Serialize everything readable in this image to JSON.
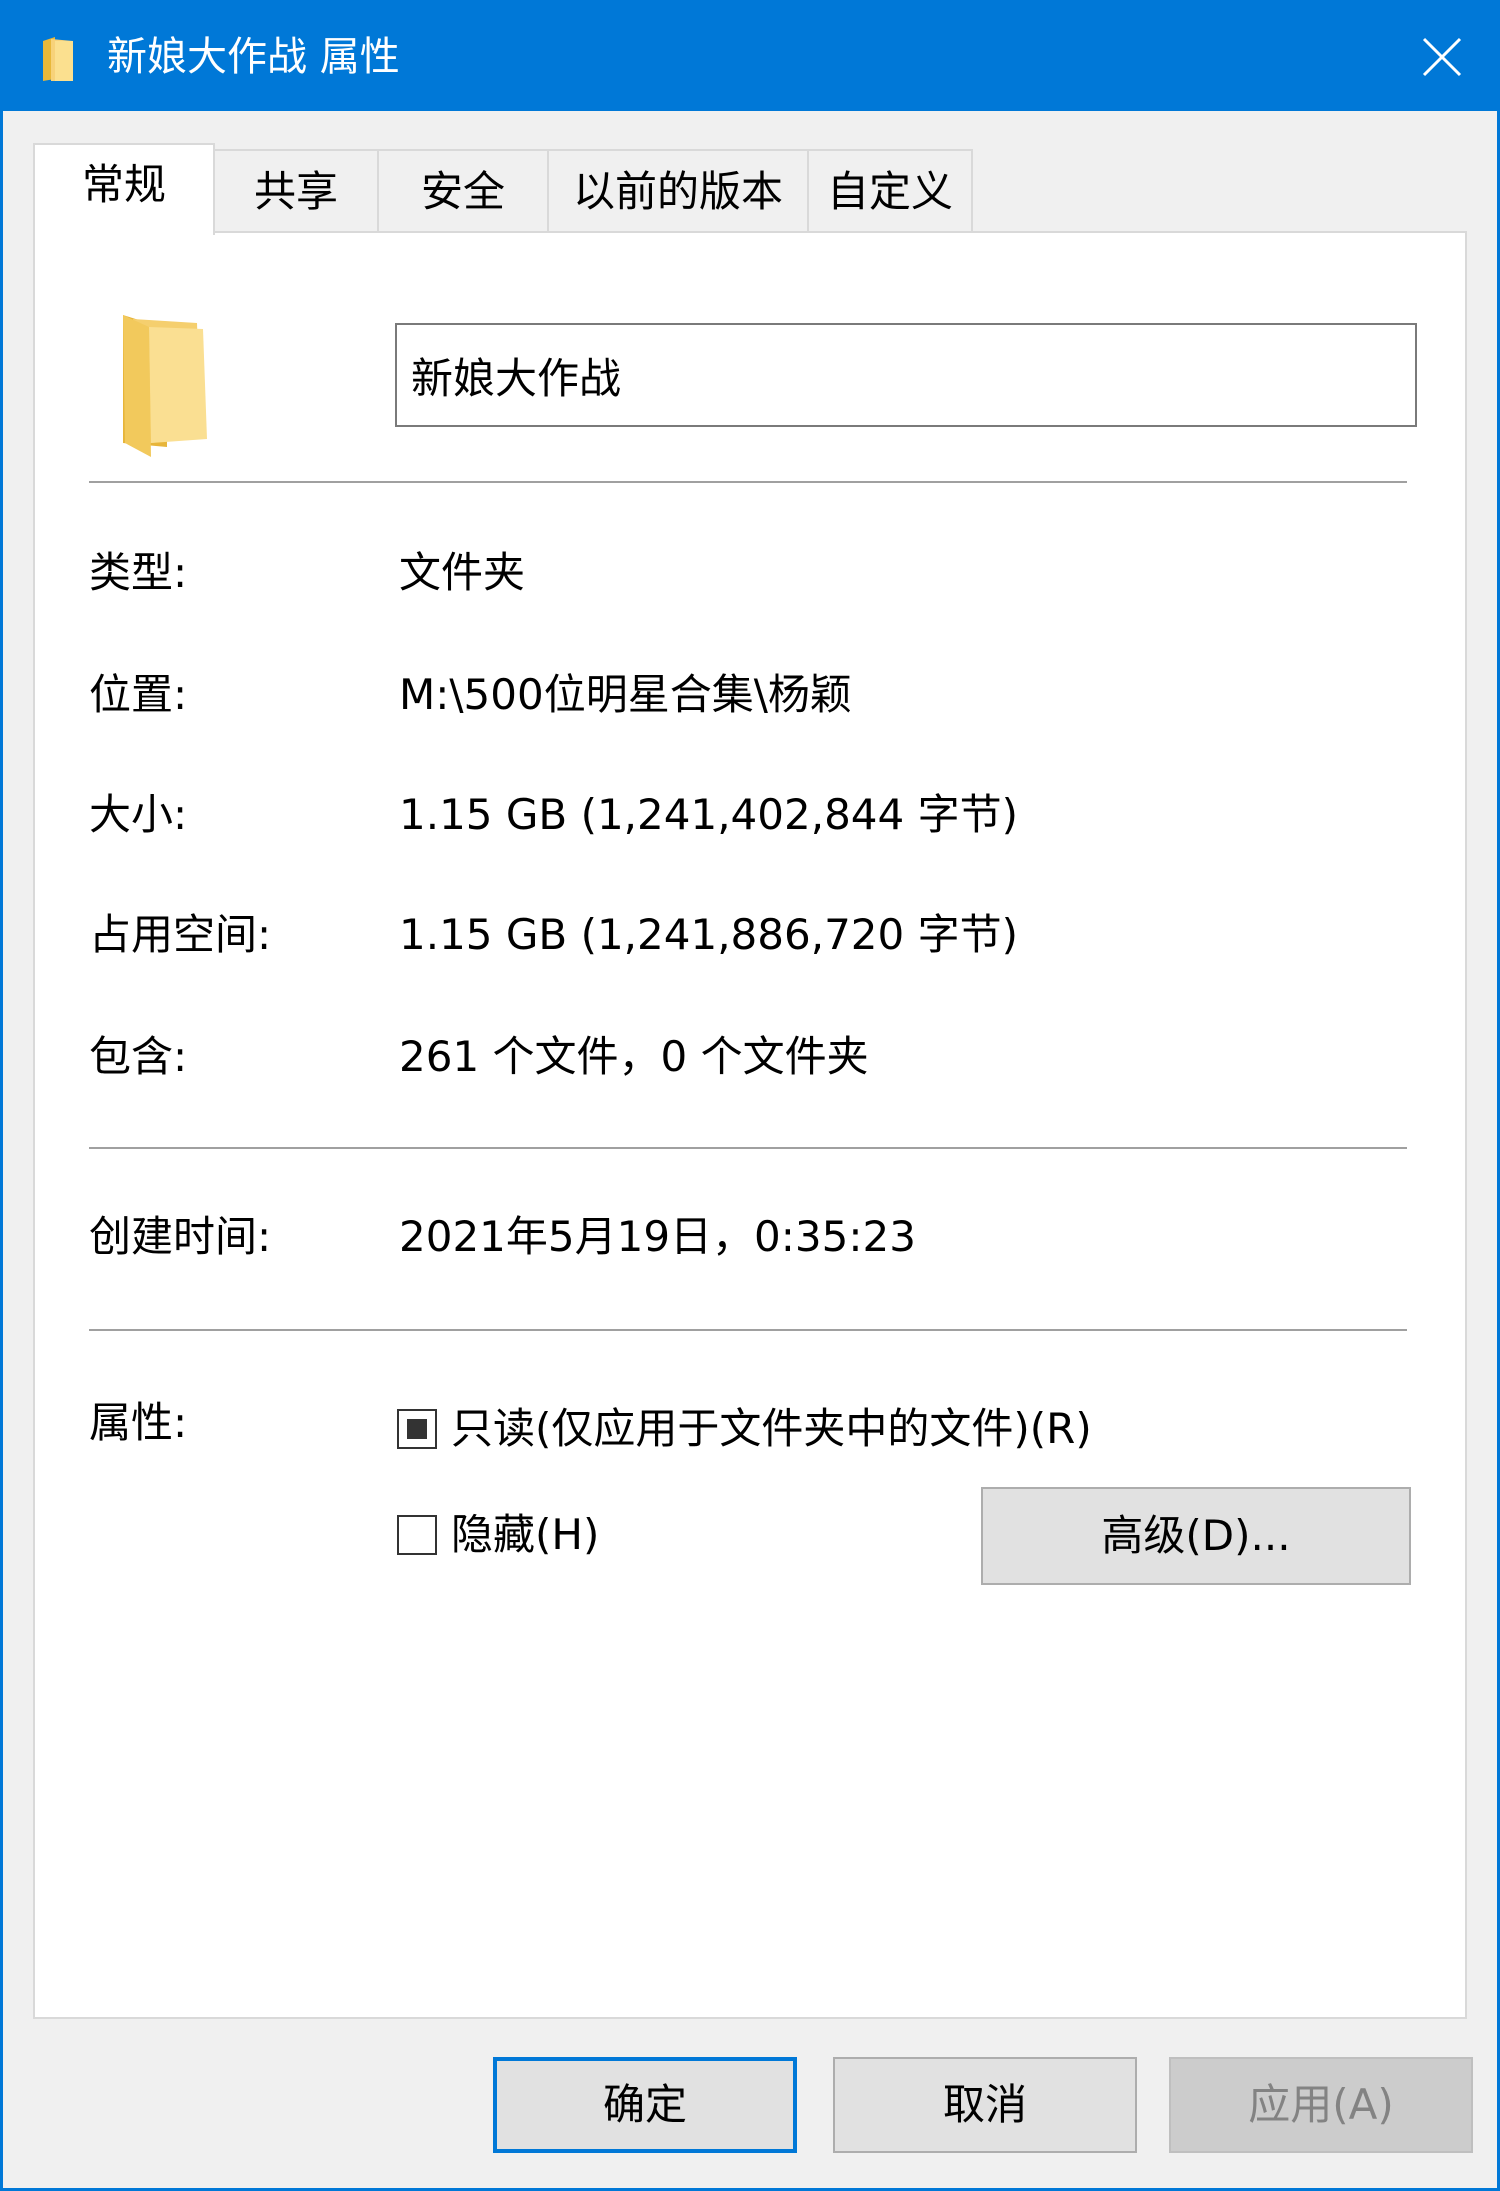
{
  "window": {
    "title": "新娘大作战 属性",
    "title_icon": "folder-icon",
    "close_icon": "close-icon"
  },
  "tabs": [
    {
      "label": "常规",
      "active": true
    },
    {
      "label": "共享",
      "active": false
    },
    {
      "label": "安全",
      "active": false
    },
    {
      "label": "以前的版本",
      "active": false
    },
    {
      "label": "自定义",
      "active": false
    }
  ],
  "general": {
    "folder_name": "新娘大作战",
    "rows": [
      {
        "label": "类型:",
        "value": "文件夹"
      },
      {
        "label": "位置:",
        "value": "M:\\500位明星合集\\杨颖"
      },
      {
        "label": "大小:",
        "value": "1.15 GB (1,241,402,844 字节)"
      },
      {
        "label": "占用空间:",
        "value": "1.15 GB (1,241,886,720 字节)"
      },
      {
        "label": "包含:",
        "value": "261 个文件，0 个文件夹"
      }
    ],
    "created": {
      "label": "创建时间:",
      "value": "2021年5月19日，0:35:23"
    },
    "attributes": {
      "label": "属性:",
      "readonly": {
        "label": "只读(仅应用于文件夹中的文件)(R)",
        "state": "indeterminate"
      },
      "hidden": {
        "label": "隐藏(H)",
        "checked": false
      },
      "advanced_button": "高级(D)..."
    }
  },
  "buttons": {
    "ok": "确定",
    "cancel": "取消",
    "apply": "应用(A)"
  },
  "colors": {
    "accent": "#0078d7",
    "folder": "#f4c64e",
    "disabled_text": "#838383"
  }
}
